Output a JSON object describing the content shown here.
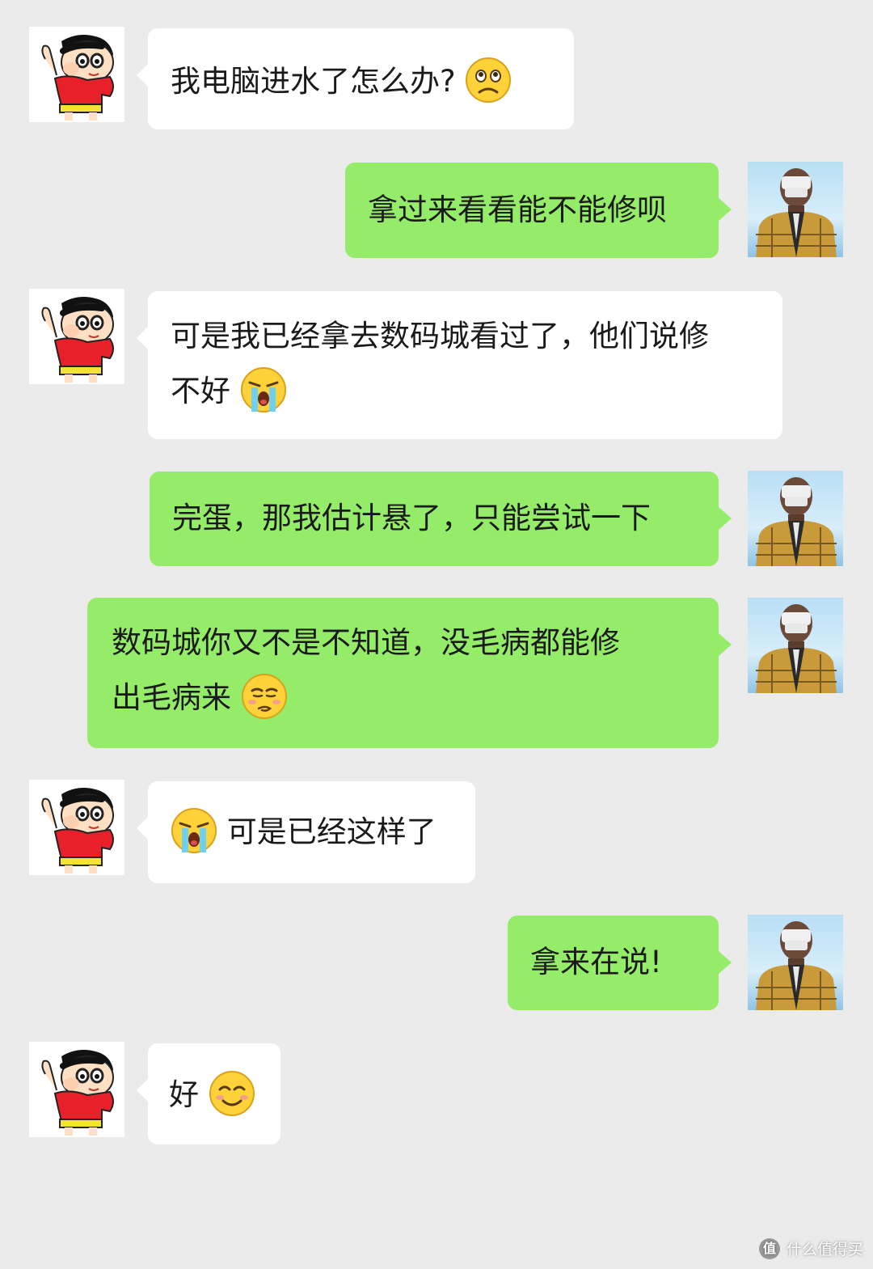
{
  "messages": [
    {
      "side": "in",
      "text": "我电脑进水了怎么办?",
      "emoji": "frown-face-icon"
    },
    {
      "side": "out",
      "text": "拿过来看看能不能修呗"
    },
    {
      "side": "in",
      "text_line1": "可是我已经拿去数码城看过了，他们说修",
      "text_line2": "不好",
      "emoji": "crying-face-icon"
    },
    {
      "side": "out",
      "text": "完蛋，那我估计悬了，只能尝试一下"
    },
    {
      "side": "out",
      "text_line1": "数码城你又不是不知道，没毛病都能修",
      "text_line2": "出毛病来",
      "emoji": "smirk-face-icon"
    },
    {
      "side": "in",
      "emoji": "crying-face-icon",
      "text": "可是已经这样了"
    },
    {
      "side": "out",
      "text": "拿来在说!"
    },
    {
      "side": "in",
      "text": "好",
      "emoji": "smile-face-icon"
    }
  ],
  "watermark": {
    "icon_text": "值",
    "text": "什么值得买"
  },
  "colors": {
    "background": "#ebebeb",
    "incoming_bubble": "#ffffff",
    "outgoing_bubble": "#95ec69",
    "text": "#1a1a1a"
  }
}
